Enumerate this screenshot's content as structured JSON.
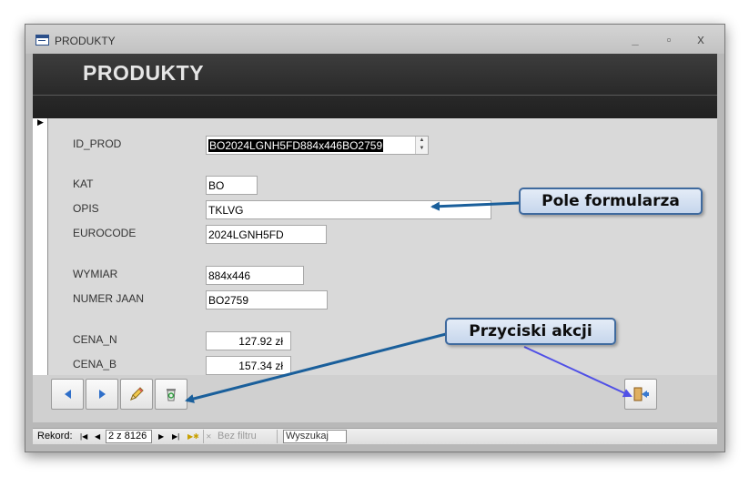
{
  "window": {
    "title": "PRODUKTY",
    "controls": {
      "minimize": "_",
      "maximize": "▫",
      "close": "x"
    }
  },
  "form": {
    "header_title": "PRODUKTY",
    "fields": {
      "id_prod": {
        "label": "ID_PROD",
        "value": "BO2024LGNH5FD884x446BO2759"
      },
      "kat": {
        "label": "KAT",
        "value": "BO"
      },
      "opis": {
        "label": "OPIS",
        "value": "TKLVG"
      },
      "eurocode": {
        "label": "EUROCODE",
        "value": "2024LGNH5FD"
      },
      "wymiar": {
        "label": "WYMIAR",
        "value": "884x446"
      },
      "numer_jaan": {
        "label": "NUMER JAAN",
        "value": "BO2759"
      },
      "cena_n": {
        "label": "CENA_N",
        "value": "127.92 zł"
      },
      "cena_b": {
        "label": "CENA_B",
        "value": "157.34 zł"
      }
    }
  },
  "buttons": {
    "prev": "previous-record",
    "next": "next-record",
    "edit": "edit-pencil",
    "delete": "delete-recycle",
    "close": "close-form-door"
  },
  "navbar": {
    "record_label": "Rekord:",
    "current": "2 z 8126",
    "filter_label": "Bez filtru",
    "search_placeholder": "Wyszukaj"
  },
  "callouts": {
    "field": "Pole formularza",
    "actions": "Przyciski akcji"
  },
  "colors": {
    "header_bg": "#2b2b2b",
    "detail_bg": "#d9d9d9",
    "callout_border": "#3f6a9e",
    "arrow": "#1a5f9b",
    "arrow_purple": "#5050e6"
  }
}
